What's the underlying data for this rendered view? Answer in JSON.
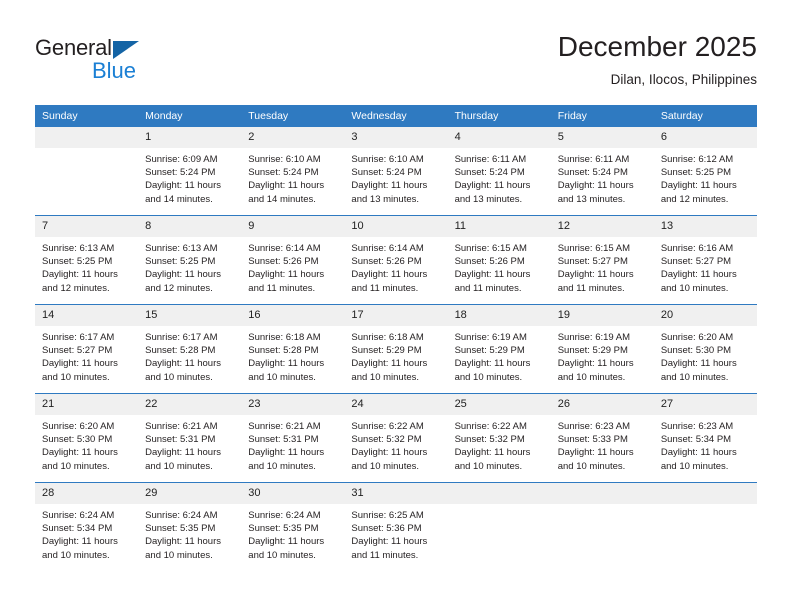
{
  "brand": {
    "name_part1": "General",
    "name_part2": "Blue",
    "triangle_color": "#1464a5",
    "blue_color": "#1a7fd4"
  },
  "header": {
    "title": "December 2025",
    "subtitle": "Dilan, Ilocos, Philippines"
  },
  "theme": {
    "header_row_bg": "#2f7ac1",
    "daynum_bg": "#f0f0f0",
    "row_divider": "#2f7ac1",
    "text": "#231f20"
  },
  "weekdays": [
    "Sunday",
    "Monday",
    "Tuesday",
    "Wednesday",
    "Thursday",
    "Friday",
    "Saturday"
  ],
  "weeks": [
    [
      {
        "day": "",
        "sunrise": "",
        "sunset": "",
        "daylight1": "",
        "daylight2": ""
      },
      {
        "day": "1",
        "sunrise": "Sunrise: 6:09 AM",
        "sunset": "Sunset: 5:24 PM",
        "daylight1": "Daylight: 11 hours",
        "daylight2": "and 14 minutes."
      },
      {
        "day": "2",
        "sunrise": "Sunrise: 6:10 AM",
        "sunset": "Sunset: 5:24 PM",
        "daylight1": "Daylight: 11 hours",
        "daylight2": "and 14 minutes."
      },
      {
        "day": "3",
        "sunrise": "Sunrise: 6:10 AM",
        "sunset": "Sunset: 5:24 PM",
        "daylight1": "Daylight: 11 hours",
        "daylight2": "and 13 minutes."
      },
      {
        "day": "4",
        "sunrise": "Sunrise: 6:11 AM",
        "sunset": "Sunset: 5:24 PM",
        "daylight1": "Daylight: 11 hours",
        "daylight2": "and 13 minutes."
      },
      {
        "day": "5",
        "sunrise": "Sunrise: 6:11 AM",
        "sunset": "Sunset: 5:24 PM",
        "daylight1": "Daylight: 11 hours",
        "daylight2": "and 13 minutes."
      },
      {
        "day": "6",
        "sunrise": "Sunrise: 6:12 AM",
        "sunset": "Sunset: 5:25 PM",
        "daylight1": "Daylight: 11 hours",
        "daylight2": "and 12 minutes."
      }
    ],
    [
      {
        "day": "7",
        "sunrise": "Sunrise: 6:13 AM",
        "sunset": "Sunset: 5:25 PM",
        "daylight1": "Daylight: 11 hours",
        "daylight2": "and 12 minutes."
      },
      {
        "day": "8",
        "sunrise": "Sunrise: 6:13 AM",
        "sunset": "Sunset: 5:25 PM",
        "daylight1": "Daylight: 11 hours",
        "daylight2": "and 12 minutes."
      },
      {
        "day": "9",
        "sunrise": "Sunrise: 6:14 AM",
        "sunset": "Sunset: 5:26 PM",
        "daylight1": "Daylight: 11 hours",
        "daylight2": "and 11 minutes."
      },
      {
        "day": "10",
        "sunrise": "Sunrise: 6:14 AM",
        "sunset": "Sunset: 5:26 PM",
        "daylight1": "Daylight: 11 hours",
        "daylight2": "and 11 minutes."
      },
      {
        "day": "11",
        "sunrise": "Sunrise: 6:15 AM",
        "sunset": "Sunset: 5:26 PM",
        "daylight1": "Daylight: 11 hours",
        "daylight2": "and 11 minutes."
      },
      {
        "day": "12",
        "sunrise": "Sunrise: 6:15 AM",
        "sunset": "Sunset: 5:27 PM",
        "daylight1": "Daylight: 11 hours",
        "daylight2": "and 11 minutes."
      },
      {
        "day": "13",
        "sunrise": "Sunrise: 6:16 AM",
        "sunset": "Sunset: 5:27 PM",
        "daylight1": "Daylight: 11 hours",
        "daylight2": "and 10 minutes."
      }
    ],
    [
      {
        "day": "14",
        "sunrise": "Sunrise: 6:17 AM",
        "sunset": "Sunset: 5:27 PM",
        "daylight1": "Daylight: 11 hours",
        "daylight2": "and 10 minutes."
      },
      {
        "day": "15",
        "sunrise": "Sunrise: 6:17 AM",
        "sunset": "Sunset: 5:28 PM",
        "daylight1": "Daylight: 11 hours",
        "daylight2": "and 10 minutes."
      },
      {
        "day": "16",
        "sunrise": "Sunrise: 6:18 AM",
        "sunset": "Sunset: 5:28 PM",
        "daylight1": "Daylight: 11 hours",
        "daylight2": "and 10 minutes."
      },
      {
        "day": "17",
        "sunrise": "Sunrise: 6:18 AM",
        "sunset": "Sunset: 5:29 PM",
        "daylight1": "Daylight: 11 hours",
        "daylight2": "and 10 minutes."
      },
      {
        "day": "18",
        "sunrise": "Sunrise: 6:19 AM",
        "sunset": "Sunset: 5:29 PM",
        "daylight1": "Daylight: 11 hours",
        "daylight2": "and 10 minutes."
      },
      {
        "day": "19",
        "sunrise": "Sunrise: 6:19 AM",
        "sunset": "Sunset: 5:29 PM",
        "daylight1": "Daylight: 11 hours",
        "daylight2": "and 10 minutes."
      },
      {
        "day": "20",
        "sunrise": "Sunrise: 6:20 AM",
        "sunset": "Sunset: 5:30 PM",
        "daylight1": "Daylight: 11 hours",
        "daylight2": "and 10 minutes."
      }
    ],
    [
      {
        "day": "21",
        "sunrise": "Sunrise: 6:20 AM",
        "sunset": "Sunset: 5:30 PM",
        "daylight1": "Daylight: 11 hours",
        "daylight2": "and 10 minutes."
      },
      {
        "day": "22",
        "sunrise": "Sunrise: 6:21 AM",
        "sunset": "Sunset: 5:31 PM",
        "daylight1": "Daylight: 11 hours",
        "daylight2": "and 10 minutes."
      },
      {
        "day": "23",
        "sunrise": "Sunrise: 6:21 AM",
        "sunset": "Sunset: 5:31 PM",
        "daylight1": "Daylight: 11 hours",
        "daylight2": "and 10 minutes."
      },
      {
        "day": "24",
        "sunrise": "Sunrise: 6:22 AM",
        "sunset": "Sunset: 5:32 PM",
        "daylight1": "Daylight: 11 hours",
        "daylight2": "and 10 minutes."
      },
      {
        "day": "25",
        "sunrise": "Sunrise: 6:22 AM",
        "sunset": "Sunset: 5:32 PM",
        "daylight1": "Daylight: 11 hours",
        "daylight2": "and 10 minutes."
      },
      {
        "day": "26",
        "sunrise": "Sunrise: 6:23 AM",
        "sunset": "Sunset: 5:33 PM",
        "daylight1": "Daylight: 11 hours",
        "daylight2": "and 10 minutes."
      },
      {
        "day": "27",
        "sunrise": "Sunrise: 6:23 AM",
        "sunset": "Sunset: 5:34 PM",
        "daylight1": "Daylight: 11 hours",
        "daylight2": "and 10 minutes."
      }
    ],
    [
      {
        "day": "28",
        "sunrise": "Sunrise: 6:24 AM",
        "sunset": "Sunset: 5:34 PM",
        "daylight1": "Daylight: 11 hours",
        "daylight2": "and 10 minutes."
      },
      {
        "day": "29",
        "sunrise": "Sunrise: 6:24 AM",
        "sunset": "Sunset: 5:35 PM",
        "daylight1": "Daylight: 11 hours",
        "daylight2": "and 10 minutes."
      },
      {
        "day": "30",
        "sunrise": "Sunrise: 6:24 AM",
        "sunset": "Sunset: 5:35 PM",
        "daylight1": "Daylight: 11 hours",
        "daylight2": "and 10 minutes."
      },
      {
        "day": "31",
        "sunrise": "Sunrise: 6:25 AM",
        "sunset": "Sunset: 5:36 PM",
        "daylight1": "Daylight: 11 hours",
        "daylight2": "and 11 minutes."
      },
      {
        "day": "",
        "sunrise": "",
        "sunset": "",
        "daylight1": "",
        "daylight2": ""
      },
      {
        "day": "",
        "sunrise": "",
        "sunset": "",
        "daylight1": "",
        "daylight2": ""
      },
      {
        "day": "",
        "sunrise": "",
        "sunset": "",
        "daylight1": "",
        "daylight2": ""
      }
    ]
  ]
}
